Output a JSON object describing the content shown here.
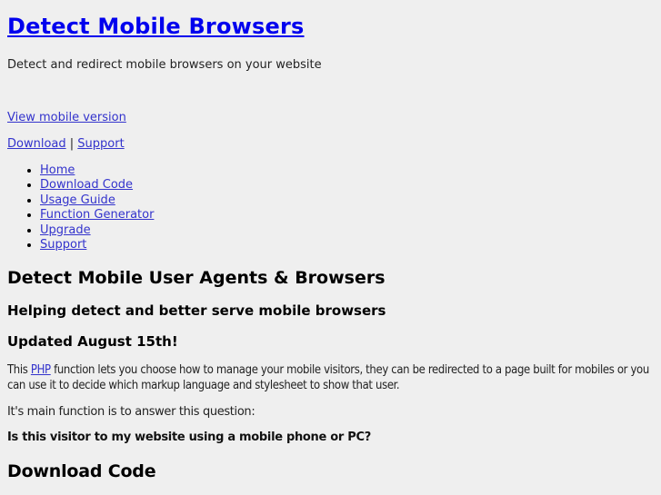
{
  "header": {
    "title": "Detect Mobile Browsers",
    "tagline": "Detect and redirect mobile browsers on your website"
  },
  "links": {
    "view_mobile": "View mobile version",
    "download": "Download",
    "separator": "|",
    "support": "Support"
  },
  "nav": {
    "items": [
      {
        "label": "Home"
      },
      {
        "label": "Download Code"
      },
      {
        "label": "Usage Guide"
      },
      {
        "label": "Function Generator"
      },
      {
        "label": "Upgrade"
      },
      {
        "label": "Support"
      }
    ]
  },
  "content": {
    "heading": "Detect Mobile User Agents & Browsers",
    "subheading1": "Helping detect and better serve mobile browsers",
    "subheading2": "Updated August 15th!",
    "desc_prefix": "This ",
    "desc_link": "PHP",
    "desc_suffix": " function lets you choose how to manage your mobile visitors, they can be redirected to a page built for mobiles or you can use it to decide which markup language and stylesheet to show that user.",
    "main_function": "It's main function is to answer this question:",
    "question": "Is this visitor to my website using a mobile phone or PC?",
    "download_heading": "Download Code"
  },
  "colors": {
    "background": "#efefef",
    "link": "#0000ee"
  }
}
